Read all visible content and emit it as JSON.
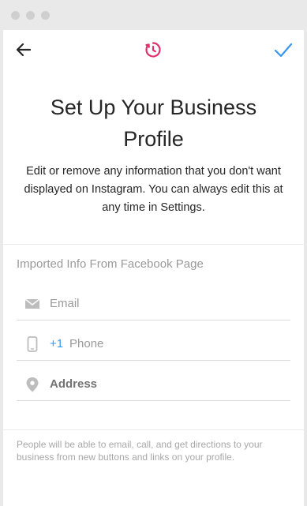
{
  "header": {
    "back_icon": "arrow-left-icon",
    "logo_icon": "business-timer-icon",
    "confirm_icon": "checkmark-icon",
    "accent": "#3897f0",
    "logo_color": "#e1306c"
  },
  "main": {
    "title": "Set Up Your Business Profile",
    "subtitle": "Edit or remove any information that you don't want displayed on Instagram. You can always edit this at any time in Settings."
  },
  "form": {
    "section_label": "Imported Info From Facebook Page",
    "email": {
      "icon": "mail-icon",
      "placeholder": "Email"
    },
    "phone": {
      "icon": "phone-icon",
      "country_code": "+1",
      "placeholder": "Phone"
    },
    "address": {
      "icon": "location-pin-icon",
      "value": "Address"
    }
  },
  "footer": {
    "note": "People will be able to email, call, and get directions to your business from new buttons and links on your profile."
  }
}
